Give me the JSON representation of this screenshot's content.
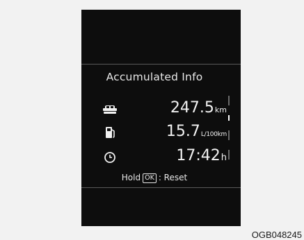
{
  "display": {
    "title": "Accumulated Info",
    "rows": [
      {
        "icon": "car-distance-icon",
        "value": "247.5",
        "unit": "km"
      },
      {
        "icon": "fuel-pump-icon",
        "value": "15.7",
        "unit": "L/100km"
      },
      {
        "icon": "clock-icon",
        "value": "17:42",
        "unit": "h"
      }
    ],
    "hint": {
      "prefix": "Hold",
      "key": "OK",
      "suffix": ": Reset"
    }
  },
  "caption": "OGB048245",
  "colors": {
    "panel": "#0d0d0d",
    "text": "#f2f2f2",
    "background": "#f2f2f2"
  }
}
